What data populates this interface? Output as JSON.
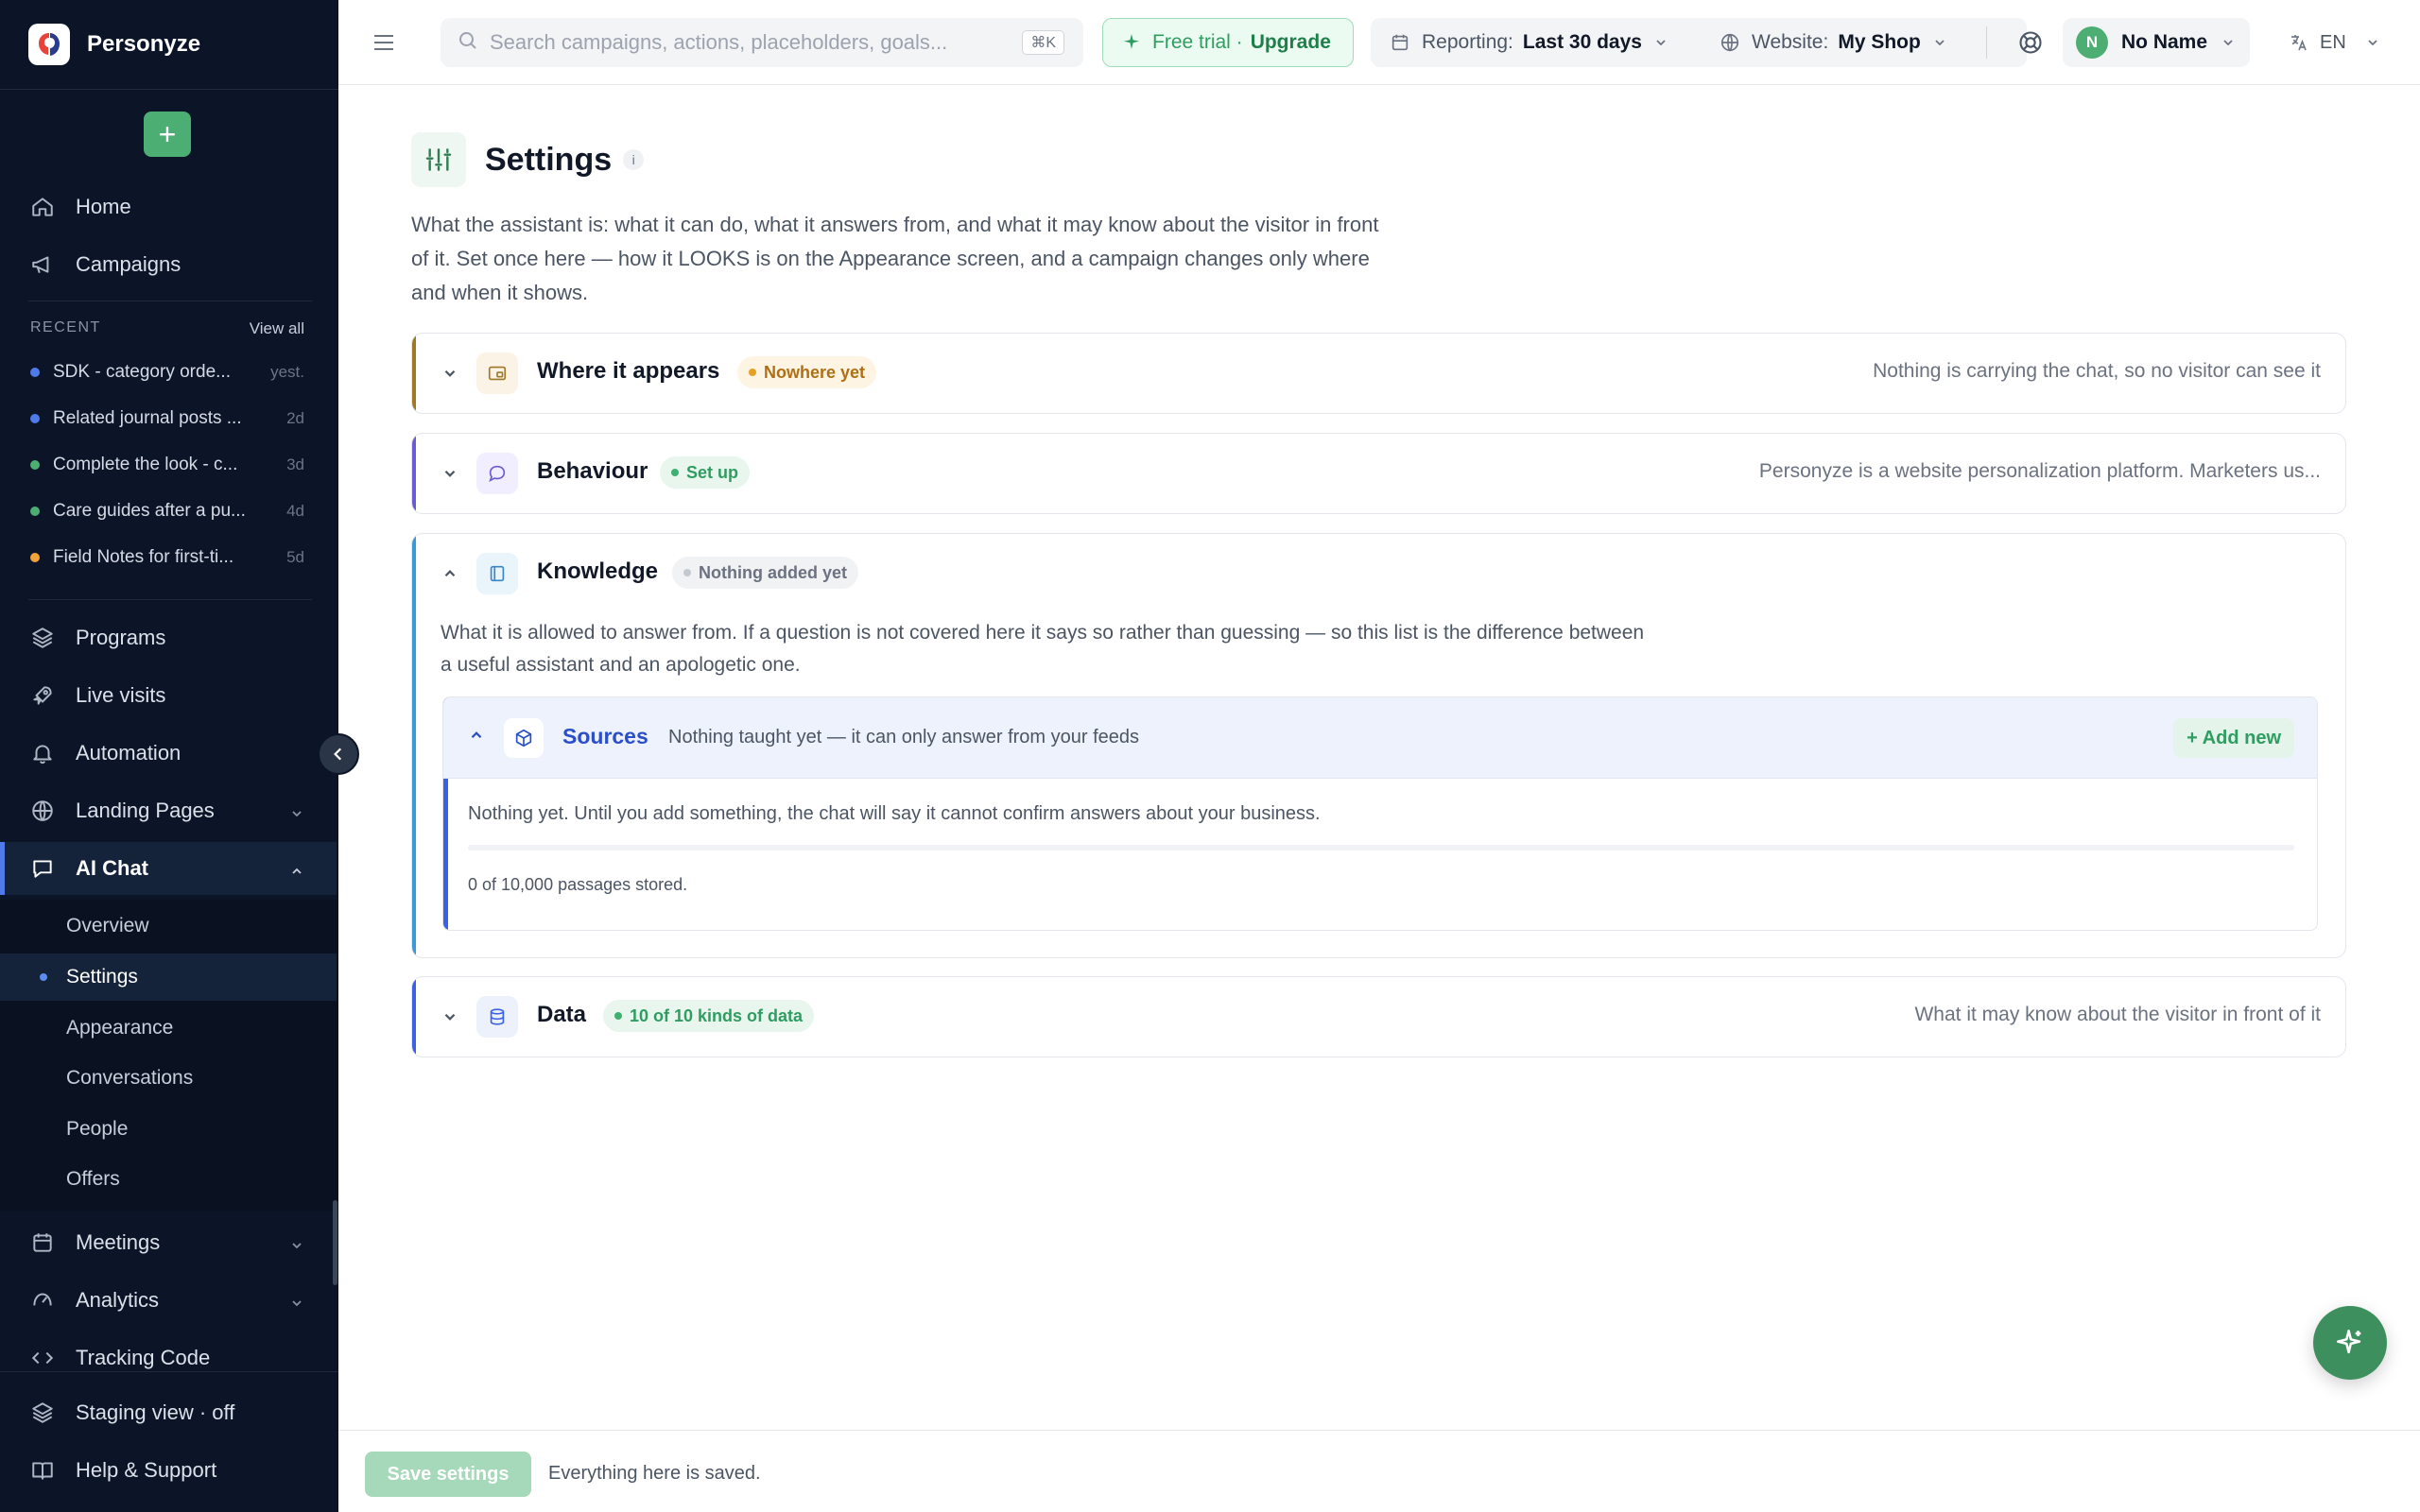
{
  "brand": {
    "name": "Personyze"
  },
  "sidebar": {
    "new_button_label": "+",
    "top_nav": [
      {
        "label": "Home",
        "icon": "home-icon"
      },
      {
        "label": "Campaigns",
        "icon": "megaphone-icon"
      }
    ],
    "recent": {
      "heading": "RECENT",
      "view_all": "View all",
      "items": [
        {
          "title": "SDK - category orde...",
          "time": "yest.",
          "color": "#4f7bea"
        },
        {
          "title": "Related journal posts ...",
          "time": "2d",
          "color": "#4f7bea"
        },
        {
          "title": "Complete the look - c...",
          "time": "3d",
          "color": "#4cae73"
        },
        {
          "title": "Care guides after a pu...",
          "time": "4d",
          "color": "#4cae73"
        },
        {
          "title": "Field Notes for first-ti...",
          "time": "5d",
          "color": "#f2a33a"
        }
      ]
    },
    "main_nav": [
      {
        "label": "Programs",
        "icon": "layers-icon"
      },
      {
        "label": "Live visits",
        "icon": "rocket-icon"
      },
      {
        "label": "Automation",
        "icon": "bell-icon"
      },
      {
        "label": "Landing Pages",
        "icon": "globe-icon"
      },
      {
        "label": "AI Chat",
        "icon": "chat-icon"
      }
    ],
    "ai_chat_sub": [
      {
        "label": "Overview"
      },
      {
        "label": "Settings"
      },
      {
        "label": "Appearance"
      },
      {
        "label": "Conversations"
      },
      {
        "label": "People"
      },
      {
        "label": "Offers"
      }
    ],
    "lower_nav": [
      {
        "label": "Meetings",
        "icon": "calendar-icon"
      },
      {
        "label": "Analytics",
        "icon": "gauge-icon"
      },
      {
        "label": "Tracking Code",
        "icon": "code-icon"
      }
    ],
    "bottom_nav": [
      {
        "label": "Staging view · off",
        "icon": "layers-icon"
      },
      {
        "label": "Help & Support",
        "icon": "book-icon"
      }
    ]
  },
  "topbar": {
    "search_placeholder": "Search campaigns, actions, placeholders, goals...",
    "search_shortcut": "⌘K",
    "trial_label": "Free trial ·",
    "trial_upgrade": "Upgrade",
    "reporting_label": "Reporting:",
    "reporting_value": "Last 30 days",
    "website_label": "Website:",
    "website_value": "My Shop",
    "user_initial": "N",
    "user_name": "No Name",
    "language": "EN"
  },
  "page": {
    "title": "Settings",
    "info": "i",
    "description": "What the assistant is: what it can do, what it answers from, and what it may know about the visitor in front of it. Set once here — how it LOOKS is on the Appearance screen, and a campaign changes only where and when it shows."
  },
  "sections": {
    "where": {
      "title": "Where it appears",
      "badge": "Nowhere yet",
      "summary": "Nothing is carrying the chat, so no visitor can see it",
      "accent": "#a07828",
      "badge_color": "#d9941f"
    },
    "behaviour": {
      "title": "Behaviour",
      "badge": "Set up",
      "summary": "Personyze is a website personalization platform. Marketers us...",
      "accent": "#6a5bd8",
      "badge_color": "#2f9d61"
    },
    "knowledge": {
      "title": "Knowledge",
      "badge": "Nothing added yet",
      "description": "What it is allowed to answer from. If a question is not covered here it says so rather than guessing — so this list is the difference between a useful assistant and an apologetic one.",
      "accent": "#3a9ad8",
      "sources": {
        "title": "Sources",
        "subtitle": "Nothing taught yet — it can only answer from your feeds",
        "add_label": "+ Add new",
        "empty_text": "Nothing yet. Until you add something, the chat will say it cannot confirm answers about your business.",
        "passages_used": 0,
        "passages_max": 10000,
        "count_text": "0 of 10,000 passages stored."
      }
    },
    "data": {
      "title": "Data",
      "badge": "10 of 10 kinds of data",
      "summary": "What it may know about the visitor in front of it",
      "accent": "#3b62e6",
      "badge_color": "#2f9d61"
    }
  },
  "footer": {
    "save_label": "Save settings",
    "status": "Everything here is saved."
  }
}
